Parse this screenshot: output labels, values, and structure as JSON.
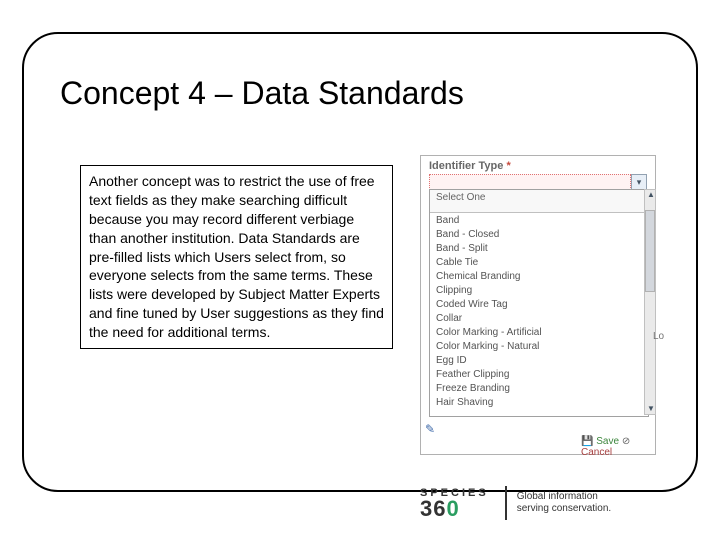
{
  "title": "Concept 4 – Data Standards",
  "body_text": "Another concept was to restrict the use of free text fields as they make searching difficult because you may record different verbiage than another institution. Data Standards are pre-filled lists which Users select from, so everyone selects from the same terms. These lists were developed by Subject Matter Experts and fine tuned by User suggestions as they find the need for additional terms.",
  "panel": {
    "field_label": "Identifier Type",
    "required_mark": "*",
    "dropdown_header": "Select One",
    "options": [
      "Band",
      "Band - Closed",
      "Band - Split",
      "Cable Tie",
      "Chemical Branding",
      "Clipping",
      "Coded Wire Tag",
      "Collar",
      "Color Marking - Artificial",
      "Color Marking - Natural",
      "Egg ID",
      "Feather Clipping",
      "Freeze Branding",
      "Hair Shaving"
    ],
    "save_label": "Save",
    "cancel_label": "Cancel",
    "side_label": "Lo"
  },
  "footer": {
    "brand_top": "SPECIES",
    "brand_num": "36",
    "brand_zero": "0",
    "tagline_line1": "Global information",
    "tagline_line2": "serving conservation."
  }
}
